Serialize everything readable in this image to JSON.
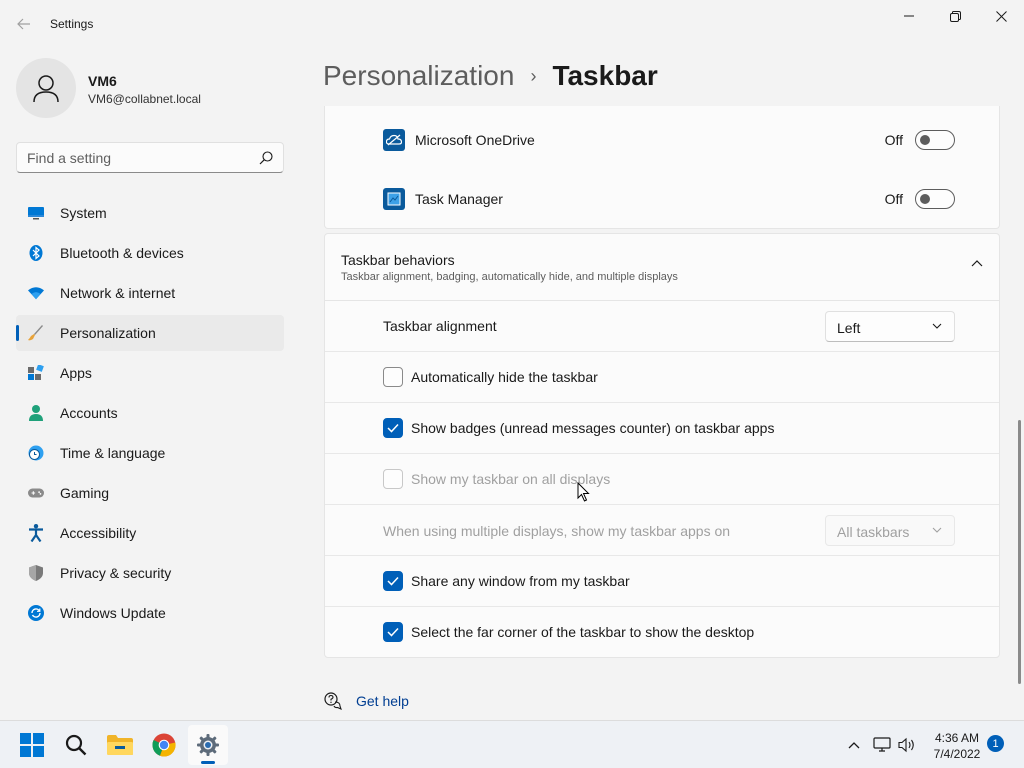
{
  "window": {
    "app_title": "Settings"
  },
  "profile": {
    "name": "VM6",
    "email": "VM6@collabnet.local"
  },
  "search": {
    "placeholder": "Find a setting",
    "value": ""
  },
  "sidebar": {
    "items": [
      {
        "label": "System",
        "icon": "monitor-icon"
      },
      {
        "label": "Bluetooth & devices",
        "icon": "bluetooth-icon"
      },
      {
        "label": "Network & internet",
        "icon": "wifi-icon"
      },
      {
        "label": "Personalization",
        "icon": "brush-icon",
        "active": true
      },
      {
        "label": "Apps",
        "icon": "apps-icon"
      },
      {
        "label": "Accounts",
        "icon": "person-icon"
      },
      {
        "label": "Time & language",
        "icon": "globe-clock-icon"
      },
      {
        "label": "Gaming",
        "icon": "gamepad-icon"
      },
      {
        "label": "Accessibility",
        "icon": "accessibility-icon"
      },
      {
        "label": "Privacy & security",
        "icon": "shield-icon"
      },
      {
        "label": "Windows Update",
        "icon": "update-icon"
      }
    ]
  },
  "header": {
    "parent": "Personalization",
    "separator": "›",
    "current": "Taskbar"
  },
  "tray_apps": [
    {
      "name": "Microsoft OneDrive",
      "state": "Off"
    },
    {
      "name": "Task Manager",
      "state": "Off"
    }
  ],
  "behaviors": {
    "title": "Taskbar behaviors",
    "subtitle": "Taskbar alignment, badging, automatically hide, and multiple displays",
    "alignment_label": "Taskbar alignment",
    "alignment_value": "Left",
    "auto_hide_label": "Automatically hide the taskbar",
    "auto_hide_checked": false,
    "badges_label": "Show badges (unread messages counter) on taskbar apps",
    "badges_checked": true,
    "all_displays_label": "Show my taskbar on all displays",
    "all_displays_checked": false,
    "multi_display_label": "When using multiple displays, show my taskbar apps on",
    "multi_display_value": "All taskbars",
    "share_label": "Share any window from my taskbar",
    "share_checked": true,
    "far_corner_label": "Select the far corner of the taskbar to show the desktop",
    "far_corner_checked": true
  },
  "footer": {
    "get_help": "Get help"
  },
  "taskbar": {
    "time": "4:36 AM",
    "date": "7/4/2022",
    "notification_count": "1"
  },
  "colors": {
    "accent": "#005fb8",
    "background": "#f3f3f3",
    "card": "#fbfbfb"
  }
}
